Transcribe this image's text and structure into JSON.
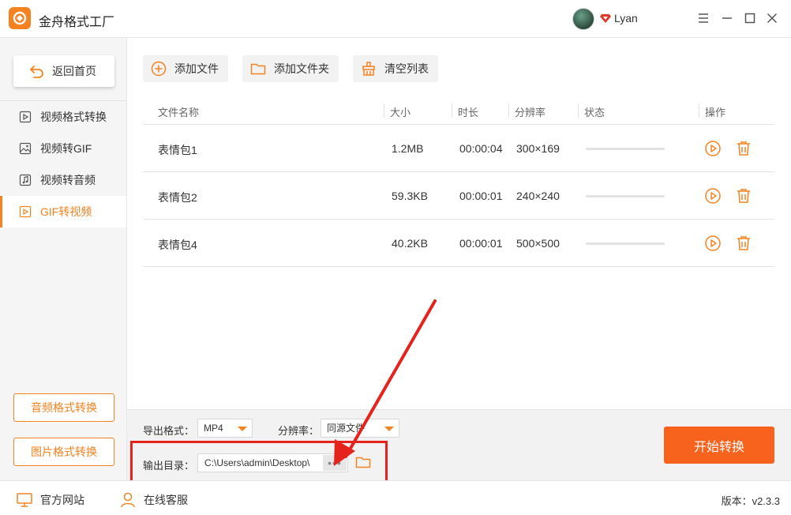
{
  "app": {
    "title": "金舟格式工厂",
    "username": "Lyan"
  },
  "sidebar": {
    "home_label": "返回首页",
    "items": [
      {
        "label": "视频格式转换",
        "icon": "video-play-icon",
        "active": false
      },
      {
        "label": "视频转GIF",
        "icon": "image-icon",
        "active": false
      },
      {
        "label": "视频转音频",
        "icon": "music-icon",
        "active": false
      },
      {
        "label": "GIF转视频",
        "icon": "video-play-icon",
        "active": true
      }
    ],
    "audio_convert_label": "音频格式转换",
    "image_convert_label": "图片格式转换"
  },
  "toolbar": {
    "add_file_label": "添加文件",
    "add_folder_label": "添加文件夹",
    "clear_list_label": "清空列表"
  },
  "table": {
    "columns": [
      "文件名称",
      "大小",
      "时长",
      "分辨率",
      "状态",
      "操作"
    ],
    "rows": [
      {
        "name": "表情包1",
        "size": "1.2MB",
        "duration": "00:00:04",
        "resolution": "300×169",
        "progress": 0
      },
      {
        "name": "表情包2",
        "size": "59.3KB",
        "duration": "00:00:01",
        "resolution": "240×240",
        "progress": 0
      },
      {
        "name": "表情包4",
        "size": "40.2KB",
        "duration": "00:00:01",
        "resolution": "500×500",
        "progress": 0
      }
    ]
  },
  "output": {
    "format_label": "导出格式：",
    "format_value": "MP4",
    "resolution_label": "分辨率：",
    "resolution_value": "同源文件",
    "dir_label": "输出目录：",
    "dir_value": "C:\\Users\\admin\\Desktop\\",
    "more_label": "•••",
    "start_label": "开始转换"
  },
  "statusbar": {
    "website_label": "官方网站",
    "support_label": "在线客服",
    "version": "版本：v2.3.3"
  },
  "colors": {
    "accent": "#f58220",
    "start_button": "#f7621c",
    "annotation": "#e5221b"
  }
}
